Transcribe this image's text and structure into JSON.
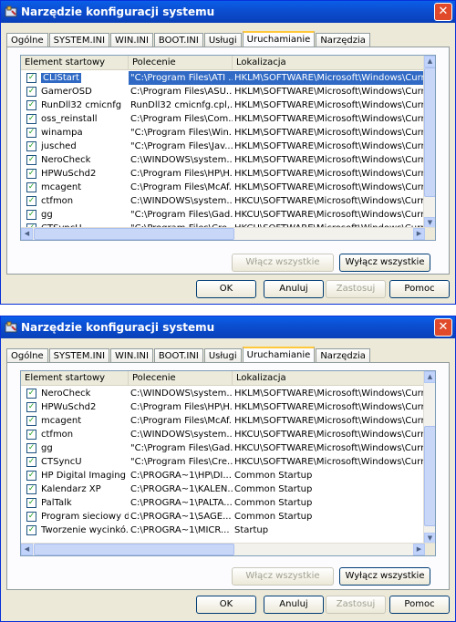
{
  "windows": [
    {
      "title": "Narzędzie konfiguracji systemu",
      "close_label": "✕",
      "tabs": [
        "Ogólne",
        "SYSTEM.INI",
        "WIN.INI",
        "BOOT.INI",
        "Usługi",
        "Uruchamianie",
        "Narzędzia"
      ],
      "active_tab": "Uruchamianie",
      "columns": [
        "Element startowy",
        "Polecenie",
        "Lokalizacja"
      ],
      "rows": [
        {
          "name": "CLIStart",
          "command": "\"C:\\Program Files\\ATI ...",
          "location": "HKLM\\SOFTWARE\\Microsoft\\Windows\\CurrentVer...",
          "checked": true
        },
        {
          "name": "GamerOSD",
          "command": "C:\\Program Files\\ASU...",
          "location": "HKLM\\SOFTWARE\\Microsoft\\Windows\\CurrentVer...",
          "checked": true
        },
        {
          "name": "RunDll32 cmicnfg",
          "command": "RunDll32 cmicnfg.cpl,...",
          "location": "HKLM\\SOFTWARE\\Microsoft\\Windows\\CurrentVer...",
          "checked": true
        },
        {
          "name": "oss_reinstall",
          "command": "C:\\Program Files\\Com...",
          "location": "HKLM\\SOFTWARE\\Microsoft\\Windows\\CurrentVer...",
          "checked": true
        },
        {
          "name": "winampa",
          "command": "\"C:\\Program Files\\Win...",
          "location": "HKLM\\SOFTWARE\\Microsoft\\Windows\\CurrentVer...",
          "checked": true
        },
        {
          "name": "jusched",
          "command": "\"C:\\Program Files\\Jav...",
          "location": "HKLM\\SOFTWARE\\Microsoft\\Windows\\CurrentVer...",
          "checked": true
        },
        {
          "name": "NeroCheck",
          "command": "C:\\WINDOWS\\system...",
          "location": "HKLM\\SOFTWARE\\Microsoft\\Windows\\CurrentVer...",
          "checked": true
        },
        {
          "name": "HPWuSchd2",
          "command": "C:\\Program Files\\HP\\H...",
          "location": "HKLM\\SOFTWARE\\Microsoft\\Windows\\CurrentVer...",
          "checked": true
        },
        {
          "name": "mcagent",
          "command": "C:\\Program Files\\McAf...",
          "location": "HKLM\\SOFTWARE\\Microsoft\\Windows\\CurrentVer...",
          "checked": true
        },
        {
          "name": "ctfmon",
          "command": "C:\\WINDOWS\\system...",
          "location": "HKCU\\SOFTWARE\\Microsoft\\Windows\\CurrentVer...",
          "checked": true
        },
        {
          "name": "gg",
          "command": "\"C:\\Program Files\\Gad...",
          "location": "HKCU\\SOFTWARE\\Microsoft\\Windows\\CurrentVer...",
          "checked": true
        },
        {
          "name": "CTSyncU",
          "command": "\"C:\\Program Files\\Cre...",
          "location": "HKCU\\SOFTWARE\\Microsoft\\Windows\\CurrentVer...",
          "checked": true
        }
      ],
      "selected_row": 0,
      "enable_all": "Włącz wszystkie",
      "disable_all": "Wyłącz wszystkie",
      "ok": "OK",
      "cancel": "Anuluj",
      "apply": "Zastosuj",
      "help": "Pomoc"
    },
    {
      "title": "Narzędzie konfiguracji systemu",
      "close_label": "✕",
      "tabs": [
        "Ogólne",
        "SYSTEM.INI",
        "WIN.INI",
        "BOOT.INI",
        "Usługi",
        "Uruchamianie",
        "Narzędzia"
      ],
      "active_tab": "Uruchamianie",
      "columns": [
        "Element startowy",
        "Polecenie",
        "Lokalizacja"
      ],
      "rows": [
        {
          "name": "NeroCheck",
          "command": "C:\\WINDOWS\\system...",
          "location": "HKLM\\SOFTWARE\\Microsoft\\Windows\\CurrentVer...",
          "checked": true
        },
        {
          "name": "HPWuSchd2",
          "command": "C:\\Program Files\\HP\\H...",
          "location": "HKLM\\SOFTWARE\\Microsoft\\Windows\\CurrentVer...",
          "checked": true
        },
        {
          "name": "mcagent",
          "command": "C:\\Program Files\\McAf...",
          "location": "HKLM\\SOFTWARE\\Microsoft\\Windows\\CurrentVer...",
          "checked": true
        },
        {
          "name": "ctfmon",
          "command": "C:\\WINDOWS\\system...",
          "location": "HKCU\\SOFTWARE\\Microsoft\\Windows\\CurrentVer...",
          "checked": true
        },
        {
          "name": "gg",
          "command": "\"C:\\Program Files\\Gad...",
          "location": "HKCU\\SOFTWARE\\Microsoft\\Windows\\CurrentVer...",
          "checked": true
        },
        {
          "name": "CTSyncU",
          "command": "\"C:\\Program Files\\Cre...",
          "location": "HKCU\\SOFTWARE\\Microsoft\\Windows\\CurrentVer...",
          "checked": true
        },
        {
          "name": "HP Digital Imaging ...",
          "command": "C:\\PROGRA~1\\HP\\DI...",
          "location": "Common Startup",
          "checked": true
        },
        {
          "name": "Kalendarz XP",
          "command": "C:\\PROGRA~1\\KALEN...",
          "location": "Common Startup",
          "checked": true
        },
        {
          "name": "PalTalk",
          "command": "C:\\PROGRA~1\\PALTA...",
          "location": "Common Startup",
          "checked": true
        },
        {
          "name": "Program sieciowy d...",
          "command": "C:\\PROGRA~1\\SAGE...",
          "location": "Common Startup",
          "checked": true
        },
        {
          "name": "Tworzenie wycinkó...",
          "command": "C:\\PROGRA~1\\MICR...",
          "location": "Startup",
          "checked": true
        }
      ],
      "selected_row": -1,
      "enable_all": "Włącz wszystkie",
      "disable_all": "Wyłącz wszystkie",
      "ok": "OK",
      "cancel": "Anuluj",
      "apply": "Zastosuj",
      "help": "Pomoc"
    }
  ],
  "colors": {
    "titlebar": "#0b4fd2",
    "selection": "#316ac5",
    "check": "#21a121"
  }
}
